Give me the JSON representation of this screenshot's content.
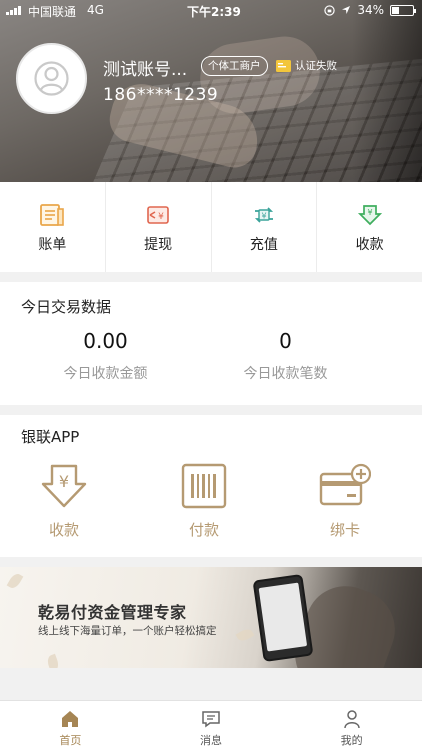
{
  "status_bar": {
    "carrier": "中国联通",
    "network": "4G",
    "time": "下午2:39",
    "battery": "34%"
  },
  "profile": {
    "name": "测试账号...",
    "account_type": "个体工商户",
    "cert_status": "认证失败",
    "phone": "186****1239"
  },
  "quick_actions": [
    {
      "label": "账单",
      "icon": "bill-icon"
    },
    {
      "label": "提现",
      "icon": "withdraw-icon"
    },
    {
      "label": "充值",
      "icon": "recharge-icon"
    },
    {
      "label": "收款",
      "icon": "receive-icon"
    }
  ],
  "today": {
    "title": "今日交易数据",
    "amount_value": "0.00",
    "amount_label": "今日收款金额",
    "count_value": "0",
    "count_label": "今日收款笔数"
  },
  "unionpay": {
    "title": "银联APP",
    "items": [
      {
        "label": "收款",
        "icon": "receive-arrow-icon"
      },
      {
        "label": "付款",
        "icon": "barcode-icon"
      },
      {
        "label": "绑卡",
        "icon": "bind-card-icon"
      }
    ]
  },
  "banner": {
    "title": "乾易付资金管理专家",
    "subtitle": "线上线下海量订单，一个账户轻松搞定"
  },
  "tabbar": [
    {
      "label": "首页",
      "icon": "home-icon",
      "active": true
    },
    {
      "label": "消息",
      "icon": "message-icon",
      "active": false
    },
    {
      "label": "我的",
      "icon": "user-icon",
      "active": false
    }
  ],
  "colors": {
    "accent": "#a58554",
    "union_gold": "#b59a72",
    "bill_orange": "#e9a64a",
    "withdraw_red": "#e0664f",
    "recharge_teal": "#3aa39a",
    "receive_green": "#3fae5e"
  }
}
